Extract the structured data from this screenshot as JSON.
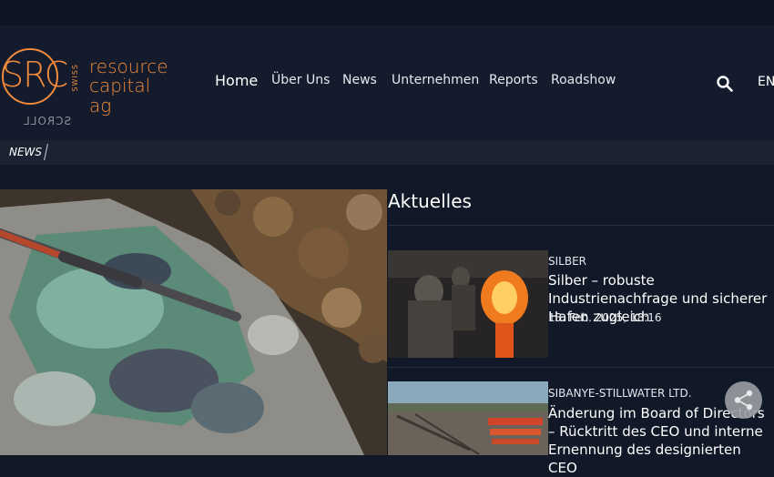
{
  "logo": {
    "mark": "SRC",
    "swiss": "SWISS",
    "line1": "resource",
    "line2": "capital ag"
  },
  "nav": {
    "items": [
      "Home",
      "Über Uns",
      "News",
      "Unternehmen",
      "Reports",
      "Roadshow"
    ]
  },
  "header": {
    "language": "EN",
    "scroll_label": "SCROLL"
  },
  "breadcrumb": {
    "label": "NEWS"
  },
  "news": {
    "section_title": "Aktuelles",
    "items": [
      {
        "category": "SILBER",
        "title": "Silber – robuste Industrienachfrage und sicherer Hafen zugleich",
        "date": "13. Feb. 2025, 18:16"
      },
      {
        "category": "SIBANYE-STILLWATER LTD.",
        "title": "Änderung im Board of Directors – Rücktritt des CEO und interne Ernennung des designierten CEO",
        "date": ""
      }
    ]
  },
  "colors": {
    "accent": "#f18a3b",
    "background": "#111827",
    "header": "#131b2c"
  },
  "icons": {
    "search": "search-icon",
    "share": "share-icon"
  }
}
